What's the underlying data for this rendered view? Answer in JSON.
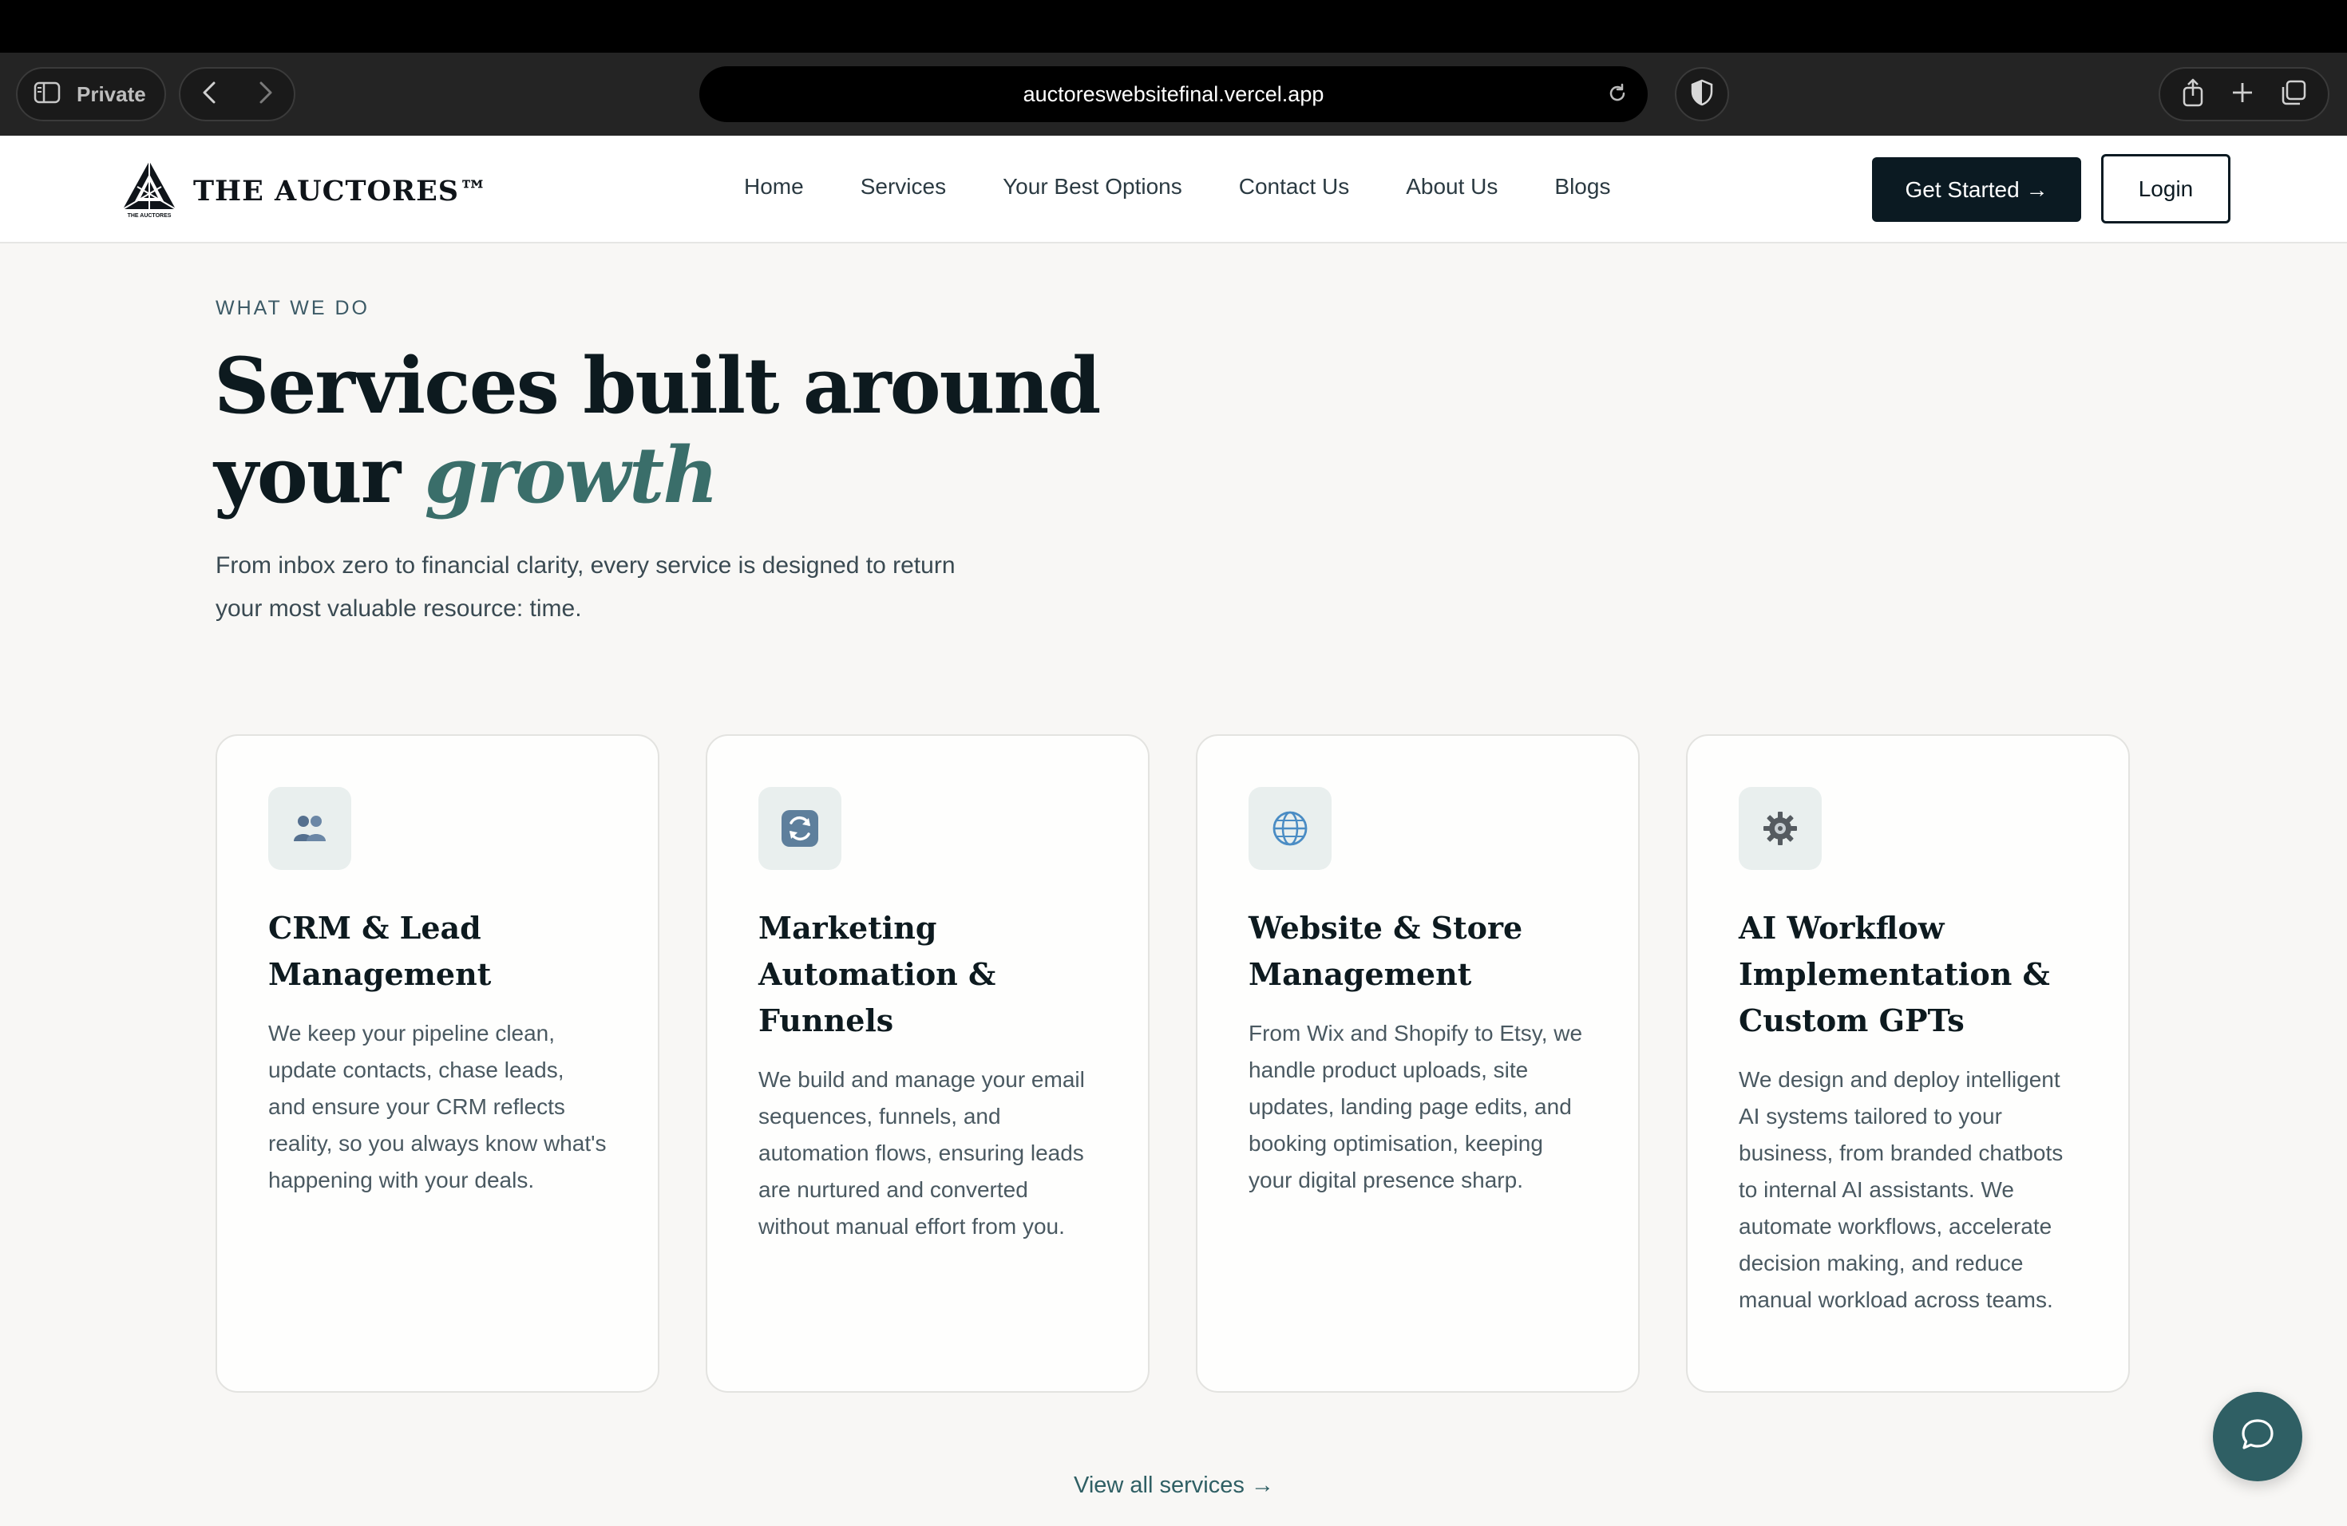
{
  "browser": {
    "private_label": "Private",
    "url": "auctoreswebsitefinal.vercel.app"
  },
  "header": {
    "brand": "THE AUCTORES™",
    "logo_caption": "THE AUCTORES",
    "nav": [
      "Home",
      "Services",
      "Your Best Options",
      "Contact Us",
      "About Us",
      "Blogs"
    ],
    "cta_label": "Get Started →",
    "login_label": "Login"
  },
  "hero": {
    "eyebrow": "WHAT WE DO",
    "headline_line1": "Services built around",
    "headline_prefix": "your ",
    "headline_accent": "growth",
    "intro_line1": "From inbox zero to financial clarity, every service is designed to return",
    "intro_line2": "your most valuable resource: time."
  },
  "services": [
    {
      "icon": "people-icon",
      "title": "CRM & Lead Management",
      "description": "We keep your pipeline clean, update contacts, chase leads, and ensure your CRM reflects reality, so you always know what's happening with your deals."
    },
    {
      "icon": "refresh-icon",
      "title": "Marketing Automation & Funnels",
      "description": "We build and manage your email sequences, funnels, and automation flows, ensuring leads are nurtured and converted without manual effort from you."
    },
    {
      "icon": "globe-icon",
      "title": "Website & Store Management",
      "description": "From Wix and Shopify to Etsy, we handle product uploads, site updates, landing page edits, and booking optimisation, keeping your digital presence sharp."
    },
    {
      "icon": "gear-icon",
      "title": "AI Workflow Implementation & Custom GPTs",
      "description": "We design and deploy intelligent AI systems tailored to your business, from branded chatbots to internal AI assistants. We automate workflows, accelerate decision making, and reduce manual workload across teams."
    }
  ],
  "view_all_label": "View all services →",
  "colors": {
    "accent": "#3a6e6a",
    "dark": "#0b1a22",
    "page_bg": "#f8f7f5"
  }
}
